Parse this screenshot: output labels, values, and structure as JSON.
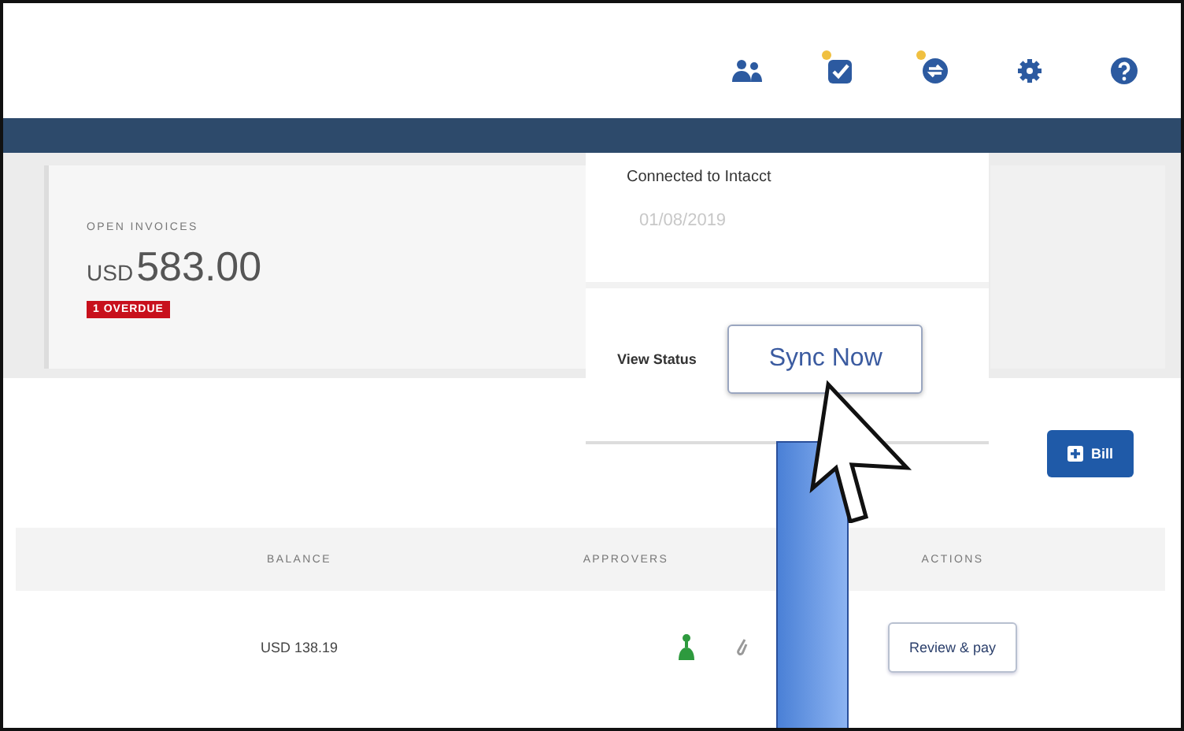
{
  "header": {
    "icons": [
      {
        "kind": "people",
        "badge": false
      },
      {
        "kind": "tasks",
        "badge": true
      },
      {
        "kind": "sync",
        "badge": true
      },
      {
        "kind": "settings",
        "badge": false
      },
      {
        "kind": "help",
        "badge": false
      }
    ]
  },
  "summary": {
    "label": "OPEN INVOICES",
    "currency": "USD",
    "amount": "583.00",
    "overdue": "1 OVERDUE"
  },
  "sync_popup": {
    "title": "Connected to Intacct",
    "date": "01/08/2019",
    "link": "View Status",
    "button": "Sync Now"
  },
  "toolbar": {
    "button": "Bill"
  },
  "table": {
    "columns": [
      "BALANCE",
      "APPROVERS",
      "ACTIONS"
    ],
    "rows": [
      {
        "balance": "USD 138.19",
        "approved": true,
        "action": "Review & pay"
      }
    ]
  }
}
